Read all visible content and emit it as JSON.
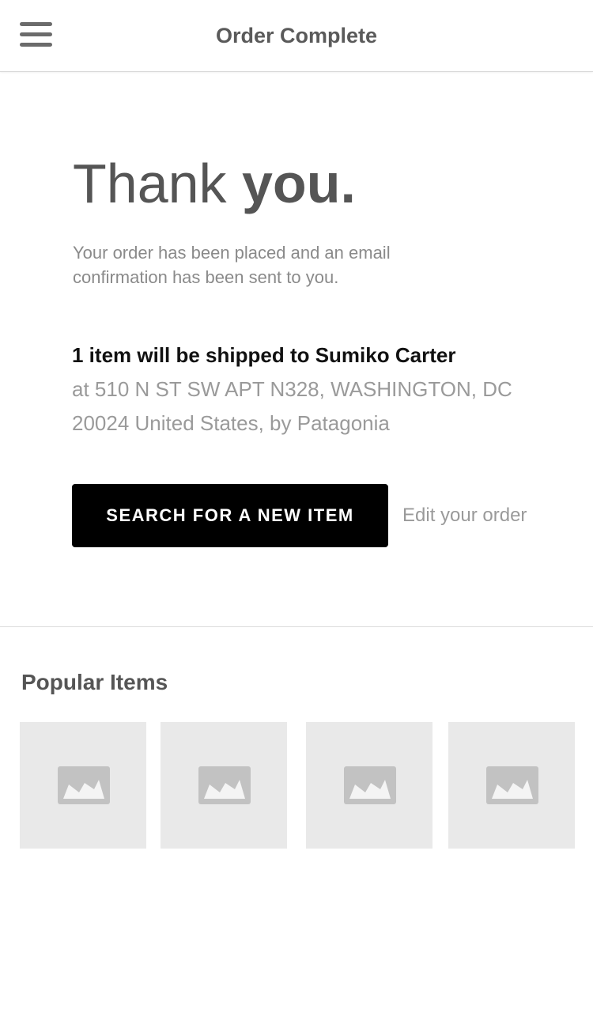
{
  "header": {
    "title": "Order Complete",
    "menu_icon": "hamburger-menu-icon"
  },
  "confirmation": {
    "thanks_light": "Thank ",
    "thanks_bold": "you.",
    "message": "Your order has been placed and an email confirmation has been sent to you."
  },
  "shipping": {
    "heading": "1 item will be shipped to Sumiko Carter",
    "address": "at 510 N ST SW APT N328, WASHINGTON, DC 20024 United States, by Patagonia"
  },
  "actions": {
    "search_label": "SEARCH FOR A NEW ITEM",
    "edit_label": "Edit your order"
  },
  "popular": {
    "title": "Popular Items",
    "items": [
      {
        "icon": "image-placeholder-icon"
      },
      {
        "icon": "image-placeholder-icon"
      },
      {
        "icon": "image-placeholder-icon"
      },
      {
        "icon": "image-placeholder-icon"
      }
    ]
  },
  "colors": {
    "button_bg": "#000000",
    "button_text": "#ffffff",
    "tile_bg": "#e9e9e9",
    "placeholder_icon": "#c2c2c2",
    "muted_text": "#8a8a8a"
  }
}
